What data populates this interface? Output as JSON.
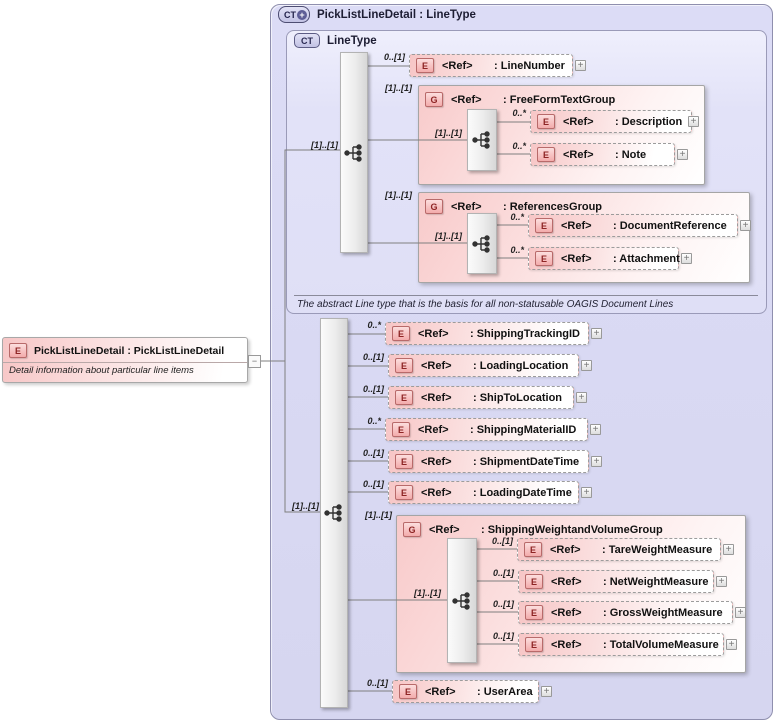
{
  "labels": {
    "ref": "<Ref>"
  },
  "badges": {
    "element": "E",
    "group": "G",
    "complex_type": "CT"
  },
  "icons": {
    "plus": "+",
    "collapse": "−"
  },
  "root": {
    "title": "PickListLineDetail : PickListLineDetail",
    "description": "Detail information about particular line items"
  },
  "container": {
    "title": "PickListLineDetail : LineType"
  },
  "linetype": {
    "title": "LineType",
    "annotation": "The abstract Line type that is the basis for all non-statusable OAGIS Document Lines",
    "seq_card": "[1]..[1]",
    "children": [
      {
        "card": "0..[1]",
        "name_label": ": LineNumber"
      },
      {
        "card": "[1]..[1]",
        "name_label": ": FreeFormTextGroup",
        "seq_card": "[1]..[1]",
        "children": [
          {
            "card": "0..*",
            "name_label": ": Description"
          },
          {
            "card": "0..*",
            "name_label": ": Note"
          }
        ]
      },
      {
        "card": "[1]..[1]",
        "name_label": ": ReferencesGroup",
        "seq_card": "[1]..[1]",
        "children": [
          {
            "card": "0..*",
            "name_label": ": DocumentReference"
          },
          {
            "card": "0..*",
            "name_label": ": Attachment"
          }
        ]
      }
    ]
  },
  "extension": {
    "seq_card": "[1]..[1]",
    "children": [
      {
        "card": "0..*",
        "name_label": ": ShippingTrackingID"
      },
      {
        "card": "0..[1]",
        "name_label": ": LoadingLocation"
      },
      {
        "card": "0..[1]",
        "name_label": ": ShipToLocation"
      },
      {
        "card": "0..*",
        "name_label": ": ShippingMaterialID"
      },
      {
        "card": "0..[1]",
        "name_label": ": ShipmentDateTime"
      },
      {
        "card": "0..[1]",
        "name_label": ": LoadingDateTime"
      },
      {
        "card": "[1]..[1]",
        "name_label": ": ShippingWeightandVolumeGroup",
        "seq_card": "[1]..[1]",
        "children": [
          {
            "card": "0..[1]",
            "name_label": ": TareWeightMeasure"
          },
          {
            "card": "0..[1]",
            "name_label": ": NetWeightMeasure"
          },
          {
            "card": "0..[1]",
            "name_label": ": GrossWeightMeasure"
          },
          {
            "card": "0..[1]",
            "name_label": ": TotalVolumeMeasure"
          }
        ]
      },
      {
        "card": "0..[1]",
        "name_label": ": UserArea"
      }
    ]
  },
  "colors": {
    "container_fill": "#d9d9f3",
    "container_border": "#8f8fae",
    "inner_type_fill": "#e4e4f9",
    "element_pink": "#f7c6c6",
    "element_border": "#9c9c9c",
    "badge_red_fill": "#f3abab",
    "badge_red_border": "#b86a6a",
    "badge_red_text": "#8e2525",
    "ct_badge_fill": "#c2c2e4",
    "wire_gray": "#7f7f7f"
  }
}
